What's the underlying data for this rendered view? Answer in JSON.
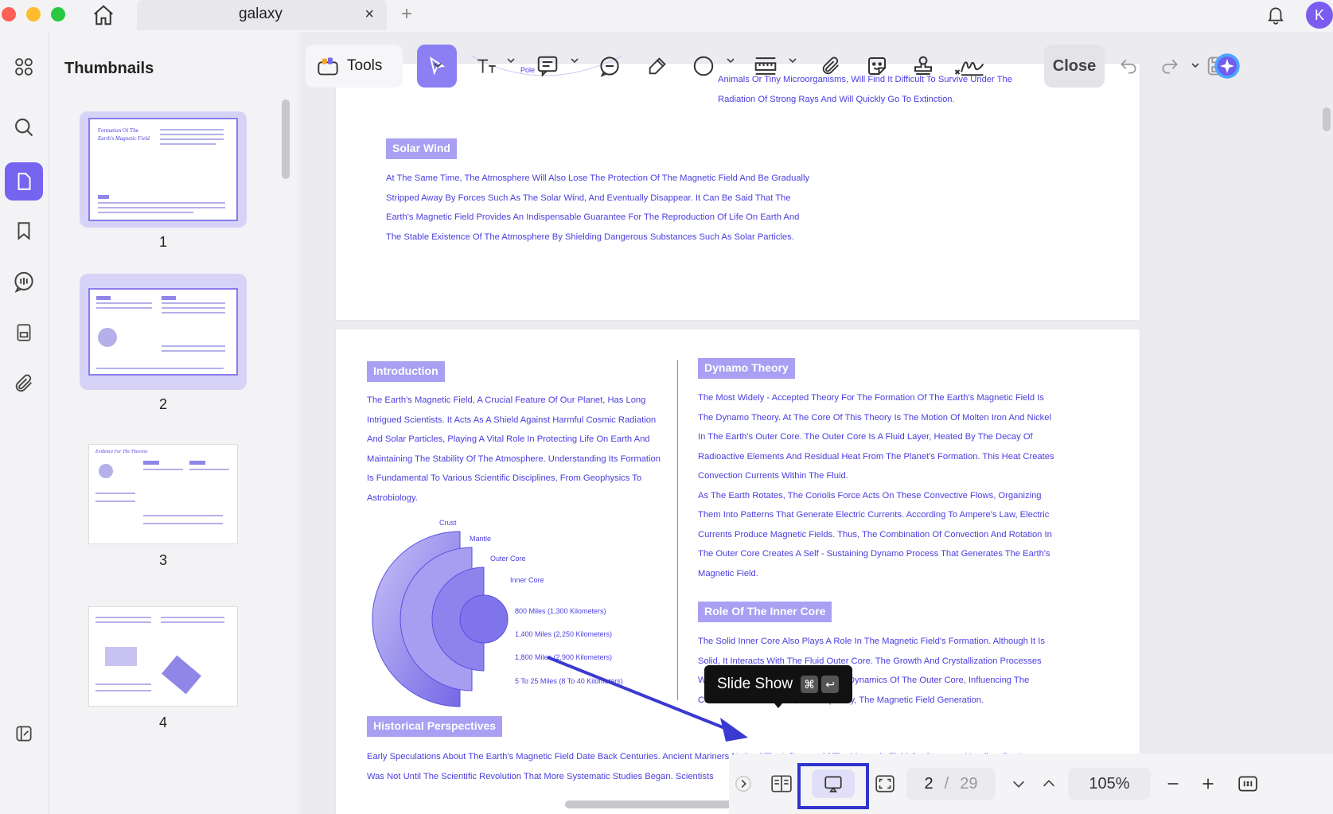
{
  "window": {
    "tab_title": "galaxy",
    "tab_close": "×",
    "tab_add": "+",
    "avatar_initial": "K"
  },
  "sidebar": {
    "title": "Thumbnails",
    "rail_icons": [
      "grid-icon",
      "search-icon",
      "pages-icon",
      "bookmark-icon",
      "comment-icon",
      "document-icon",
      "attachment-icon",
      "sidebar-toggle-icon"
    ],
    "thumbnails": [
      {
        "number": "1",
        "selected": true,
        "heading": "Formation Of The",
        "subheading": "Earth's Magnetic Field"
      },
      {
        "number": "2",
        "selected": true
      },
      {
        "number": "3",
        "selected": false,
        "heading": "Evidence For The Theories"
      },
      {
        "number": "4",
        "selected": false
      }
    ]
  },
  "toolbar": {
    "tools_label": "Tools",
    "close_label": "Close"
  },
  "page1": {
    "pole_label": "Pole",
    "right_lines": [
      "Animals Or Tiny Microorganisms, Will Find It Difficult To Survive Under The",
      "Radiation Of Strong Rays And Will Quickly Go To Extinction."
    ],
    "solar_wind_heading": "Solar Wind",
    "solar_wind_lines": [
      "At The Same Time, The Atmosphere Will Also Lose The Protection Of The Magnetic Field And Be Gradually",
      "Stripped Away By Forces Such As The Solar Wind, And Eventually Disappear. It Can Be Said That The",
      "Earth's Magnetic Field Provides An Indispensable Guarantee For The Reproduction Of Life On Earth And",
      "The Stable Existence Of The Atmosphere By Shielding Dangerous Substances Such As Solar Particles."
    ]
  },
  "page2": {
    "intro_heading": "Introduction",
    "intro_lines": [
      "The Earth's Magnetic Field, A Crucial Feature Of Our Planet, Has Long",
      "Intrigued Scientists. It Acts As A Shield Against Harmful Cosmic Radiation",
      "And Solar Particles, Playing A Vital Role In Protecting Life On Earth And",
      "Maintaining The Stability Of The Atmosphere. Understanding Its Formation",
      "Is Fundamental To Various Scientific Disciplines, From Geophysics To",
      "Astrobiology."
    ],
    "diagram_labels": {
      "crust": "Crust",
      "mantle": "Mantle",
      "outer_core": "Outer Core",
      "inner_core": "Inner Core",
      "d1": "800 Miles (1,300 Kilometers)",
      "d2": "1,400 Miles (2,250 Kilometers)",
      "d3": "1,800 Miles (2,900 Kilometers)",
      "d4": "5 To 25 Miles (8 To 40 Kilometers)"
    },
    "historical_heading": "Historical Perspectives",
    "historical_lines": [
      "Early Speculations About The Earth's Magnetic Field Date Back Centuries. Ancient Mariners Noticed The Influence Of The Magnetic Field On Compass Needles, But It",
      "Was Not Until The Scientific Revolution That More Systematic Studies Began. Scientists"
    ],
    "dynamo_heading": "Dynamo Theory",
    "dynamo_lines": [
      "The Most Widely - Accepted Theory For The Formation Of The Earth's Magnetic Field Is",
      "The Dynamo Theory. At The Core Of This Theory Is The Motion Of Molten Iron And Nickel",
      "In The Earth's Outer Core. The Outer Core Is A Fluid Layer, Heated By The Decay Of",
      "Radioactive Elements And Residual Heat From The Planet's Formation. This Heat Creates",
      "Convection Currents Within The Fluid.",
      "As The Earth Rotates, The Coriolis Force Acts On These Convective Flows, Organizing",
      "Them Into Patterns That Generate Electric Currents. According To Ampere's Law, Electric",
      "Currents Produce Magnetic Fields. Thus, The Combination Of Convection And Rotation In",
      "The Outer Core Creates A Self - Sustaining Dynamo Process That Generates The Earth's",
      "Magnetic Field."
    ],
    "inner_core_heading": "Role Of The Inner Core",
    "inner_core_lines": [
      "The Solid Inner Core Also Plays A Role In The Magnetic Field's Formation. Although It Is",
      "Solid, It Interacts With The Fluid Outer Core. The Growth And Crystallization Processes",
      "Within The Inner Core Can Affect The Dynamics Of The Outer Core, Influencing The",
      "Convective Patterns And, Consequently, The Magnetic Field Generation."
    ]
  },
  "tooltip": {
    "label": "Slide Show",
    "key_cmd": "⌘",
    "key_return": "↩"
  },
  "bottom_bar": {
    "current_page": "2",
    "separator": "/",
    "total_pages": "29",
    "zoom": "105%"
  },
  "colors": {
    "accent": "#7464f0",
    "doc_text": "#4b3ee0",
    "heading_bg": "#a99ff3",
    "highlight_box": "#2f34cc"
  }
}
